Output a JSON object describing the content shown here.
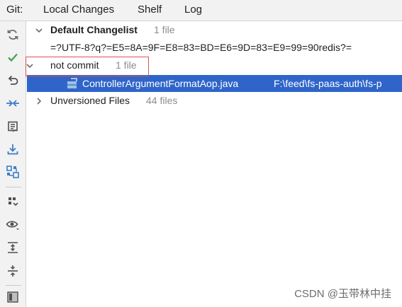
{
  "tabbar": {
    "git_label": "Git:",
    "tabs": [
      {
        "label": "Local Changes",
        "active": true
      },
      {
        "label": "Shelf",
        "active": false
      },
      {
        "label": "Log",
        "active": false
      }
    ]
  },
  "toolbar": {
    "icons": [
      "refresh-icon",
      "commit-check-icon",
      "rollback-icon",
      "diff-icon",
      "changelist-icon",
      "update-icon",
      "group-icon",
      "expand-modules-icon",
      "view-options-icon",
      "expand-all-icon",
      "collapse-all-icon",
      "panel-icon"
    ]
  },
  "tree": {
    "default_changelist": {
      "name": "Default Changelist",
      "count": "1 file",
      "child": "=?UTF-8?q?=E5=8A=9F=E8=83=BD=E6=9D=83=E9=99=90redis?="
    },
    "not_commit": {
      "name": "not commit",
      "count": "1 file",
      "file": "ControllerArgumentFormatAop.java",
      "path": "F:\\feed\\fs-paas-auth\\fs-p"
    },
    "unversioned": {
      "name": "Unversioned Files",
      "count": "44 files"
    }
  },
  "watermark": "CSDN @玉带林中挂",
  "colors": {
    "accent_tab": "#4083c9",
    "selection": "#2f65ca",
    "highlight_box": "#d9534f",
    "check_green": "#4ca05a"
  }
}
